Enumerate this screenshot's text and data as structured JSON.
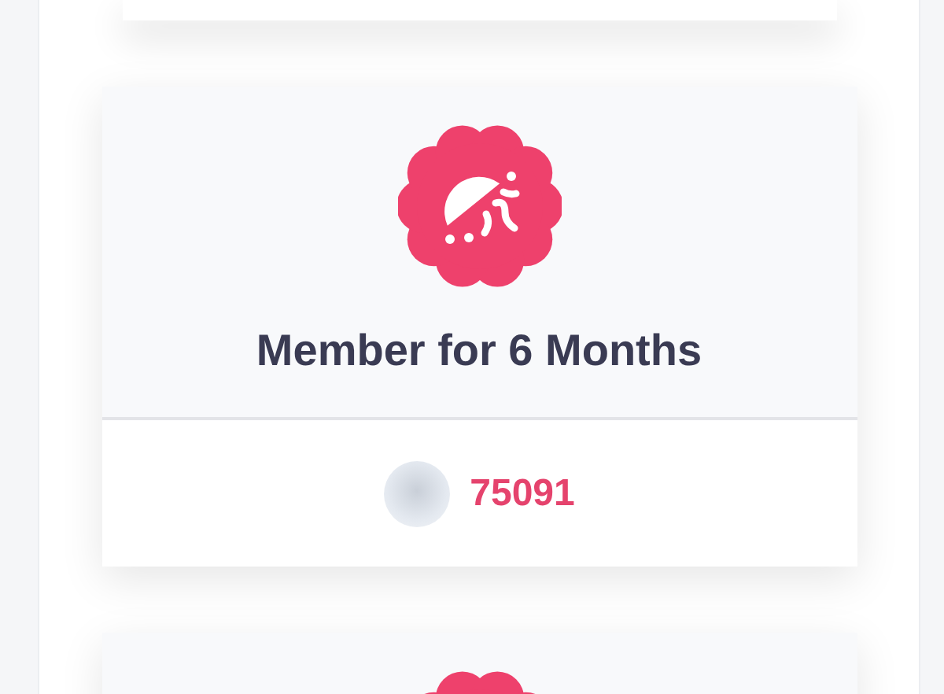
{
  "badge_card": {
    "title": "Member for 6 Months",
    "member_count": "75091"
  }
}
